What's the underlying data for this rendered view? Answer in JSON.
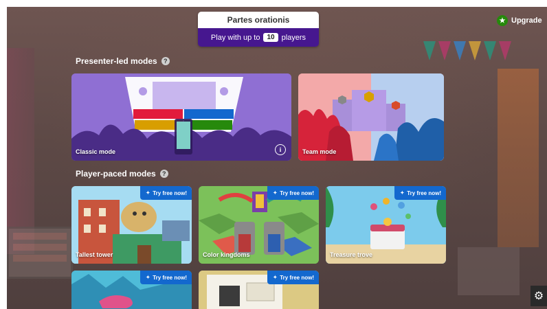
{
  "header": {
    "game_title": "Partes orationis",
    "players_prefix": "Play with up to",
    "players_count": "10",
    "players_suffix": "players",
    "upgrade_label": "Upgrade"
  },
  "presenter_section": {
    "title": "Presenter-led modes",
    "cards": [
      {
        "label": "Classic mode"
      },
      {
        "label": "Team mode"
      }
    ]
  },
  "player_section": {
    "title": "Player-paced modes",
    "badge_label": "Try free now!",
    "cards": [
      {
        "label": "Tallest tower"
      },
      {
        "label": "Color kingdoms"
      },
      {
        "label": "Treasure trove"
      },
      {
        "label": ""
      },
      {
        "label": ""
      }
    ]
  },
  "colors": {
    "accent_purple": "#46178f",
    "badge_blue": "#1368ce",
    "upgrade_green": "#26890c"
  },
  "icons": {
    "upgrade": "star-icon",
    "help": "question-icon",
    "info": "info-icon",
    "badge": "sparkle-icon",
    "settings": "gear-icon"
  }
}
